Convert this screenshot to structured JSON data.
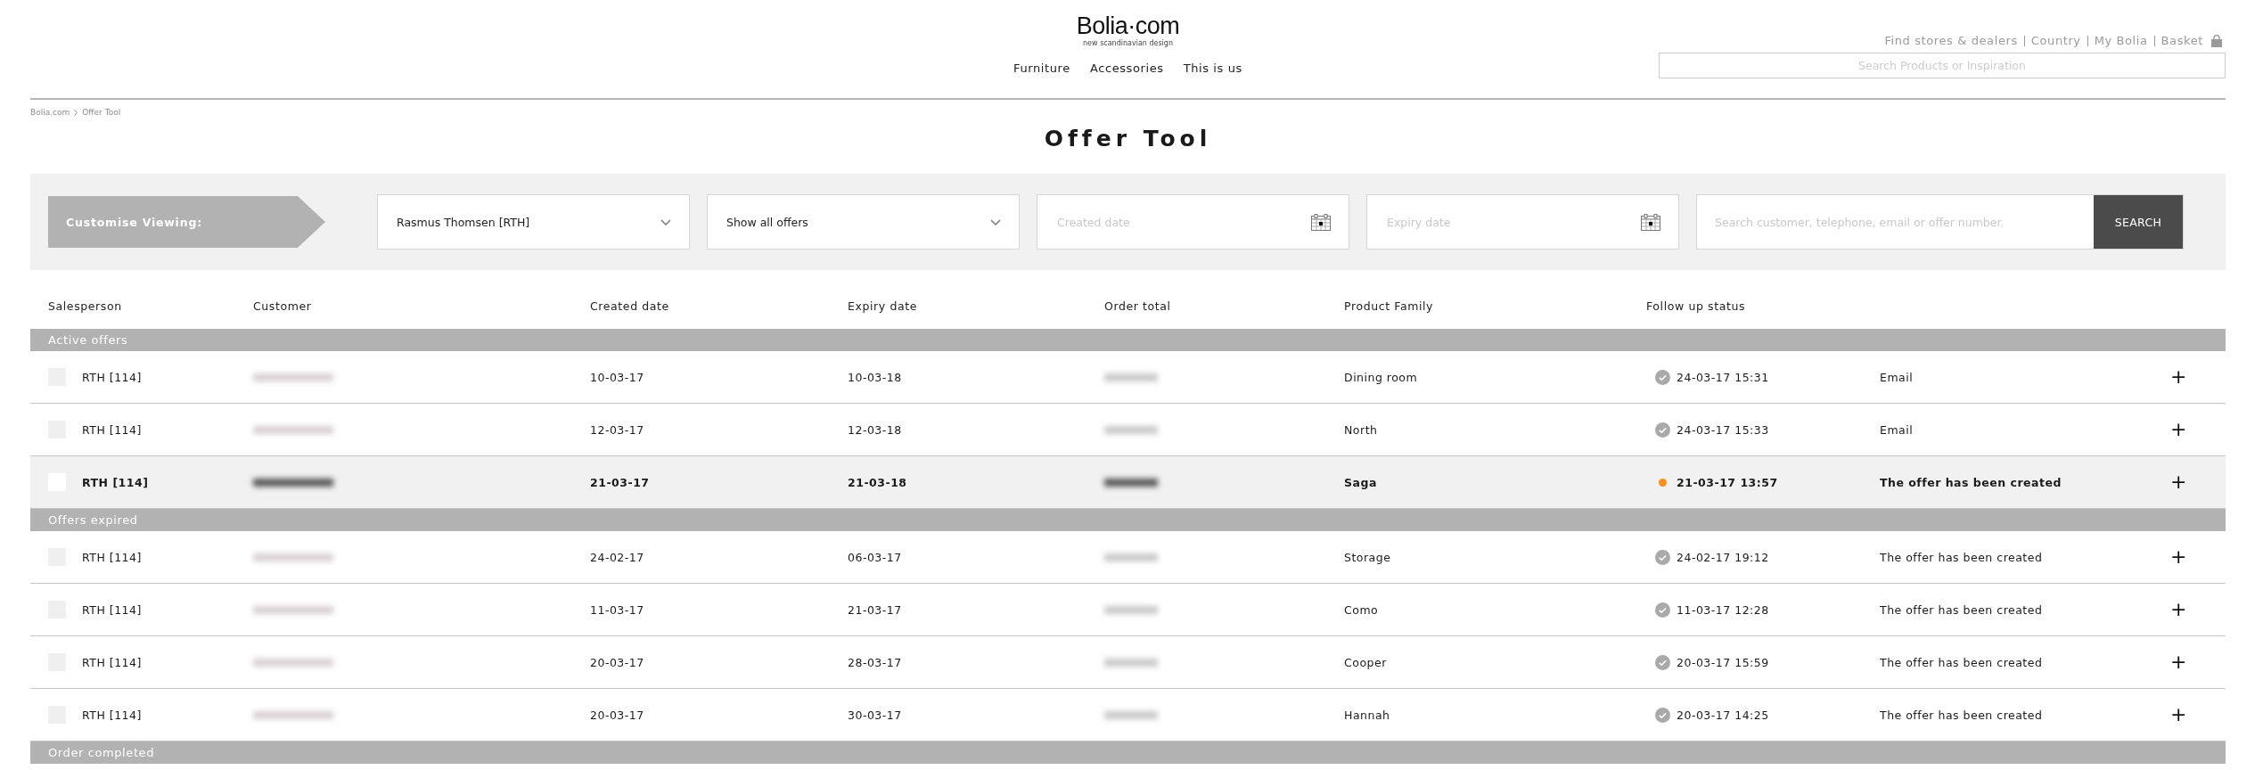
{
  "header": {
    "logo": "Bolia·com",
    "tagline": "new scandinavian design",
    "nav": [
      {
        "label": "Furniture"
      },
      {
        "label": "Accessories"
      },
      {
        "label": "This is us"
      }
    ],
    "utility_links": [
      {
        "label": "Find stores & dealers"
      },
      {
        "label": "Country"
      },
      {
        "label": "My Bolia"
      },
      {
        "label": "Basket"
      }
    ],
    "search": {
      "placeholder": "Search Products or Inspiration"
    }
  },
  "breadcrumb": [
    {
      "label": "Bolia.com"
    },
    {
      "label": "Offer Tool"
    }
  ],
  "title": "Offer Tool",
  "filters": {
    "label": "Customise Viewing:",
    "dropdowns": [
      {
        "value": "Rasmus Thomsen [RTH]"
      },
      {
        "value": "Show all offers"
      }
    ],
    "dates": [
      {
        "placeholder": "Created date"
      },
      {
        "placeholder": "Expiry date"
      }
    ],
    "search": {
      "placeholder": "Search customer, telephone, email or offer number."
    },
    "search_button": "SEARCH"
  },
  "table": {
    "columns": [
      "Salesperson",
      "Customer",
      "Created date",
      "Expiry date",
      "Order total",
      "Product Family",
      "Follow up status"
    ],
    "groups": [
      {
        "title": "Active offers",
        "rows": [
          {
            "salesperson": "RTH [114]",
            "checked": false,
            "highlighted": false,
            "created": "10-03-17",
            "expiry": "10-03-18",
            "product_family": "Dining room",
            "follow_up_done": true,
            "follow_up": "24-03-17 15:31",
            "note": "Email",
            "action": "+"
          },
          {
            "salesperson": "RTH [114]",
            "checked": false,
            "highlighted": false,
            "created": "12-03-17",
            "expiry": "12-03-18",
            "product_family": "North",
            "follow_up_done": true,
            "follow_up": "24-03-17 15:33",
            "note": "Email",
            "action": "+"
          },
          {
            "salesperson": "RTH [114]",
            "checked": false,
            "highlighted": true,
            "created": "21-03-17",
            "expiry": "21-03-18",
            "product_family": "Saga",
            "follow_up_done": false,
            "follow_up": "21-03-17 13:57",
            "note": "The offer has been created",
            "action": "+"
          }
        ]
      },
      {
        "title": "Offers expired",
        "rows": [
          {
            "salesperson": "RTH [114]",
            "checked": false,
            "highlighted": false,
            "created": "24-02-17",
            "expiry": "06-03-17",
            "product_family": "Storage",
            "follow_up_done": true,
            "follow_up": "24-02-17 19:12",
            "note": "The offer has been created",
            "action": "+"
          },
          {
            "salesperson": "RTH [114]",
            "checked": false,
            "highlighted": false,
            "created": "11-03-17",
            "expiry": "21-03-17",
            "product_family": "Como",
            "follow_up_done": true,
            "follow_up": "11-03-17 12:28",
            "note": "The offer has been created",
            "action": "+"
          },
          {
            "salesperson": "RTH [114]",
            "checked": false,
            "highlighted": false,
            "created": "20-03-17",
            "expiry": "28-03-17",
            "product_family": "Cooper",
            "follow_up_done": true,
            "follow_up": "20-03-17 15:59",
            "note": "The offer has been created",
            "action": "+"
          },
          {
            "salesperson": "RTH [114]",
            "checked": false,
            "highlighted": false,
            "created": "20-03-17",
            "expiry": "30-03-17",
            "product_family": "Hannah",
            "follow_up_done": true,
            "follow_up": "20-03-17 14:25",
            "note": "The offer has been created",
            "action": "+"
          }
        ]
      },
      {
        "title": "Order completed"
      }
    ]
  }
}
